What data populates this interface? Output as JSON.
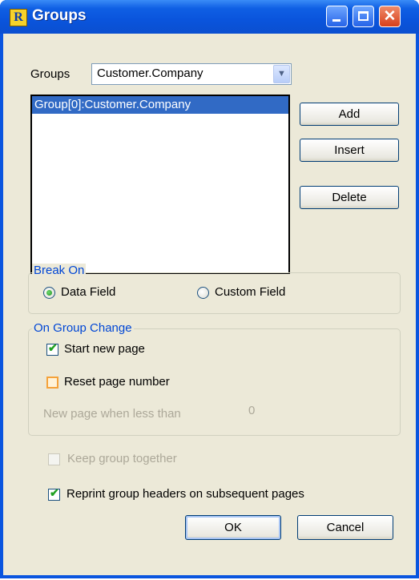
{
  "window": {
    "title": "Groups",
    "app_icon_letter": "R"
  },
  "groups_label": "Groups",
  "groups_combo": {
    "value": "Customer.Company"
  },
  "group_list": [
    "Group[0]:Customer.Company"
  ],
  "buttons": {
    "add": "Add",
    "insert": "Insert",
    "delete": "Delete",
    "ok": "OK",
    "cancel": "Cancel"
  },
  "break_on": {
    "title": "Break On",
    "data_field": {
      "label": "Data Field",
      "selected": true
    },
    "custom_field": {
      "label": "Custom Field",
      "selected": false
    }
  },
  "on_group_change": {
    "title": "On Group Change",
    "start_new_page": {
      "label": "Start new page",
      "checked": true
    },
    "reset_page_number": {
      "label": "Reset page number",
      "checked": false
    },
    "new_page_when_less_than": {
      "label": "New page when less than",
      "value": "0"
    }
  },
  "keep_group_together": {
    "label": "Keep group together",
    "checked": false,
    "enabled": false
  },
  "reprint_group_headers": {
    "label": "Reprint group headers on subsequent pages",
    "checked": true
  },
  "colors": {
    "title_bar": "#0a55df",
    "dialog_bg": "#ece9d8",
    "selection": "#316ac5",
    "group_title": "#0046d5"
  }
}
